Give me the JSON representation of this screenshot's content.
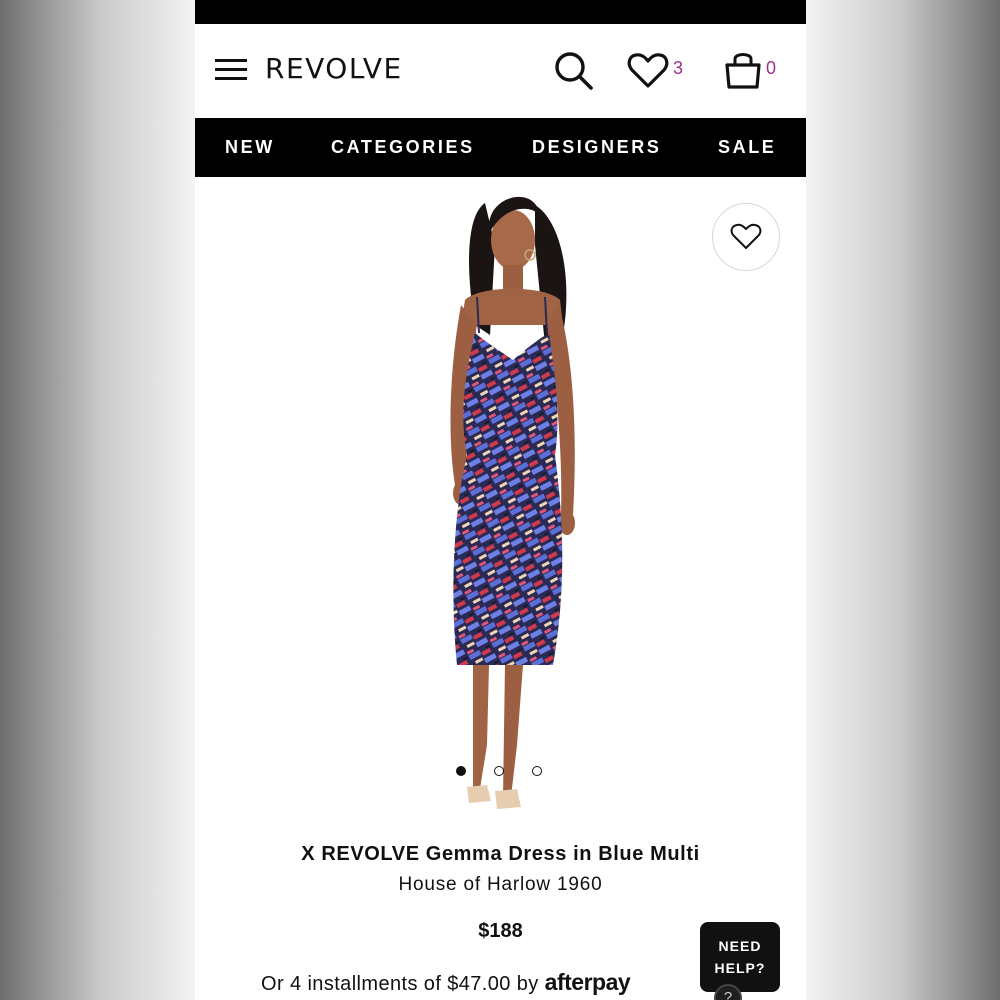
{
  "header": {
    "logo": "REVOLVE",
    "wishlist_count": "3",
    "bag_count": "0",
    "icons": [
      "menu-icon",
      "search-icon",
      "heart-icon",
      "shopping-bag-icon"
    ]
  },
  "nav": {
    "items": [
      {
        "label": "NEW"
      },
      {
        "label": "CATEGORIES"
      },
      {
        "label": "DESIGNERS"
      },
      {
        "label": "SALE"
      }
    ]
  },
  "product": {
    "title": "X REVOLVE Gemma Dress in Blue Multi",
    "brand": "House of Harlow 1960",
    "price": "$188",
    "installments_prefix": "Or 4 installments of $47.00 by",
    "afterpay_logo": "afterpay",
    "image_count": 3,
    "active_image": 1
  },
  "help": {
    "line1": "NEED",
    "line2": "HELP?",
    "tail": "?"
  },
  "colors": {
    "accent": "#a0308c",
    "nav_bg": "#000000",
    "dress_blue": "#5b6fd6",
    "dress_red": "#d23a4c"
  }
}
